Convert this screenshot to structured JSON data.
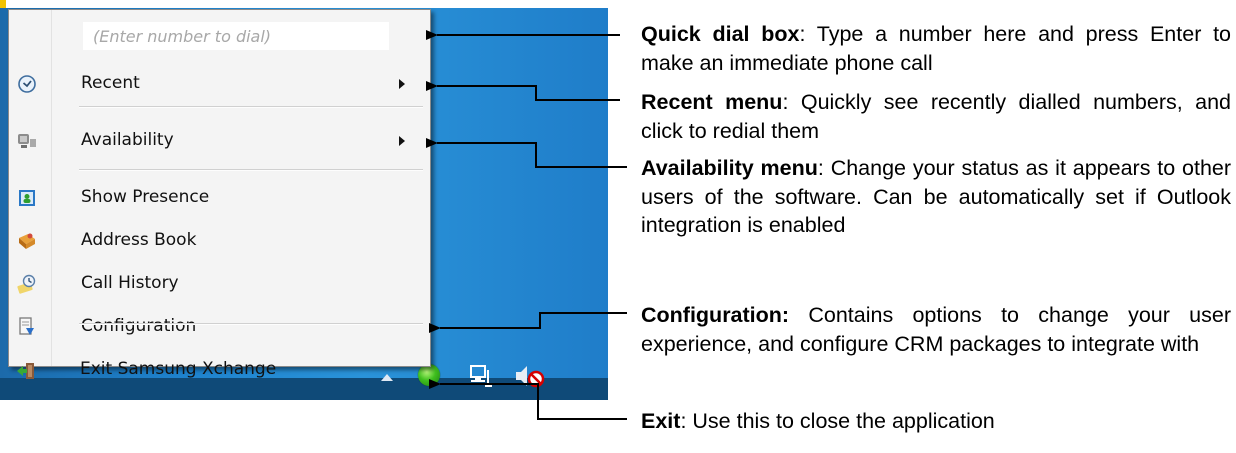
{
  "menu": {
    "dial_placeholder": "(Enter number to dial)",
    "items": [
      {
        "label": "Recent",
        "icon": "clock-icon",
        "submenu": true
      },
      {
        "label": "Availability",
        "icon": "availability-icon",
        "submenu": true
      },
      {
        "label": "Show Presence",
        "icon": "presence-icon"
      },
      {
        "label": "Address Book",
        "icon": "address-book-icon"
      },
      {
        "label": "Call History",
        "icon": "call-history-icon"
      },
      {
        "label": "Configuration",
        "icon": "configuration-icon"
      },
      {
        "label": "Exit Samsung Xchange",
        "icon": "exit-icon"
      }
    ]
  },
  "tray": {
    "icons": [
      "show-hidden-icons-arrow",
      "presence-status-icon",
      "network-icon",
      "volume-muted-icon"
    ]
  },
  "annotations": [
    {
      "title": "Quick dial box",
      "sep": ":",
      "text": " Type a number here and press Enter to make an immediate phone call"
    },
    {
      "title": "Recent menu",
      "sep": ":",
      "text": " Quickly see recently dialled numbers, and click to redial them"
    },
    {
      "title": "Availability menu",
      "sep": ":",
      "text": " Change your status as it appears to other users of the software. Can be automatically set if Outlook integration is enabled"
    },
    {
      "title": "Configuration:",
      "sep": "",
      "text": " Contains options to change your user experience, and configure CRM packages to integrate with"
    },
    {
      "title": "Exit",
      "sep": ":",
      "text": " Use this to close the application"
    }
  ],
  "colors": {
    "desktop_blue": "#1e82cd",
    "menu_bg": "#f4f4f4",
    "presence_green": "#3fbf1f"
  }
}
